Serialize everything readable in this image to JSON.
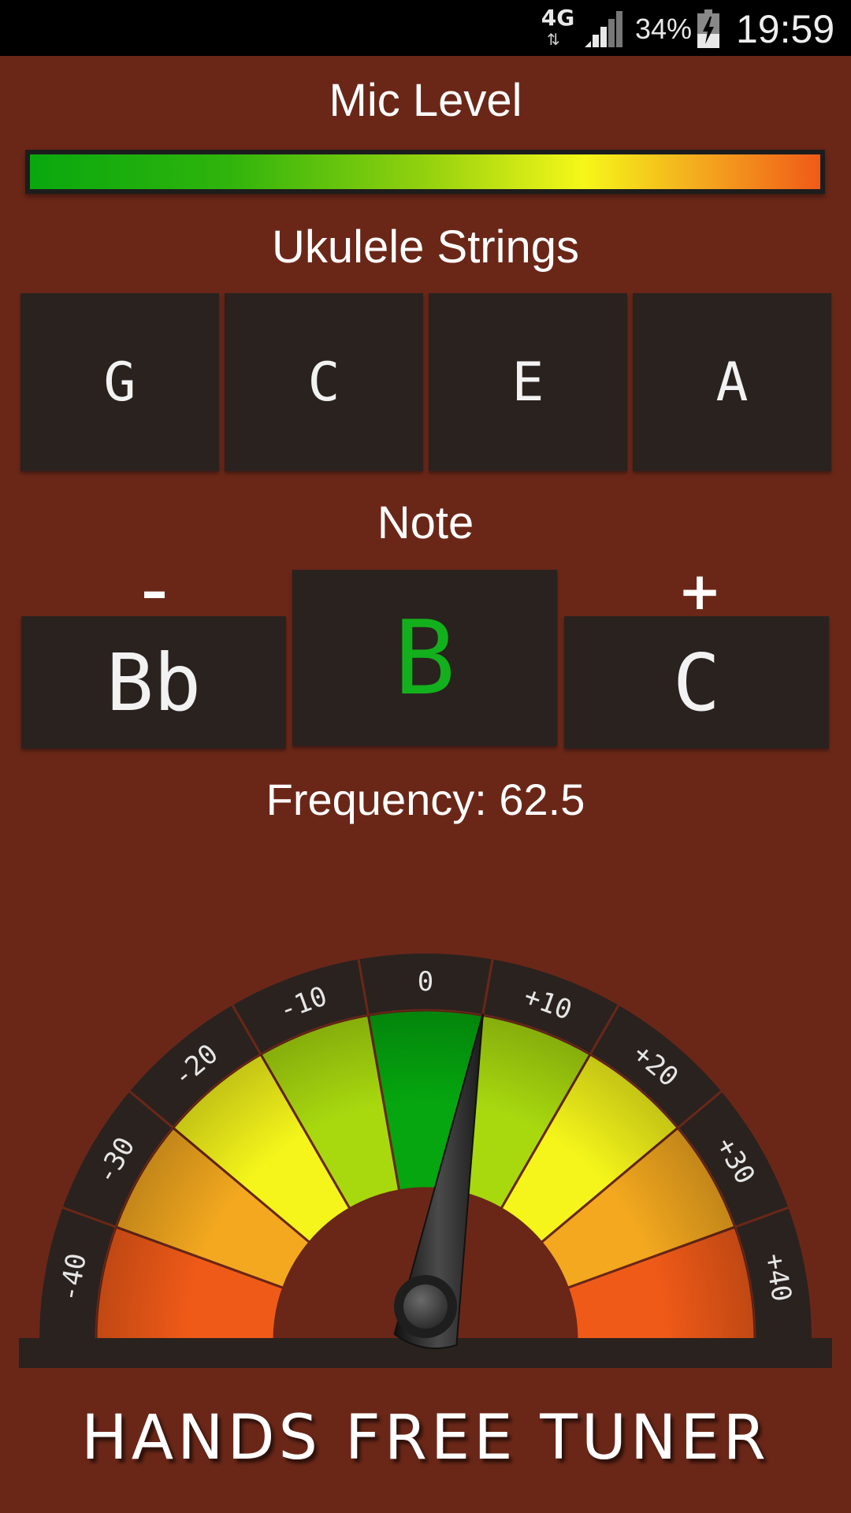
{
  "status_bar": {
    "network": "4G",
    "battery_percent": "34%",
    "time": "19:59"
  },
  "mic": {
    "title": "Mic Level",
    "level_fraction": 1.0
  },
  "strings": {
    "title": "Ukulele Strings",
    "items": [
      {
        "label": "G"
      },
      {
        "label": "C"
      },
      {
        "label": "E"
      },
      {
        "label": "A"
      }
    ]
  },
  "note": {
    "title": "Note",
    "minus_sign": "–",
    "plus_sign": "+",
    "flat": "Bb",
    "current": "B",
    "sharp": "C",
    "current_color": "#13b01d"
  },
  "frequency": {
    "text": "Frequency: 62.5"
  },
  "gauge": {
    "ticks": [
      "-40",
      "-30",
      "-20",
      "-10",
      "0",
      "+10",
      "+20",
      "+30",
      "+40"
    ],
    "needle_cents": 5,
    "colors": {
      "center": "#05a60f",
      "near": "#a8d90f",
      "mid": "#f5f51b",
      "far": "#f3a81f",
      "edge": "#f05a18"
    }
  },
  "footer": {
    "title": "HANDS FREE TUNER"
  }
}
